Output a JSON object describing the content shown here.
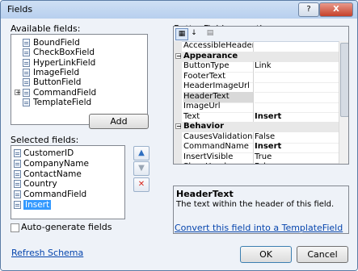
{
  "window": {
    "title": "Fields",
    "help_label": "?",
    "close_label": "X"
  },
  "available": {
    "label": "Available fields:",
    "items": [
      {
        "label": "BoundField",
        "expandable": false
      },
      {
        "label": "CheckBoxField",
        "expandable": false
      },
      {
        "label": "HyperLinkField",
        "expandable": false
      },
      {
        "label": "ImageField",
        "expandable": false
      },
      {
        "label": "ButtonField",
        "expandable": false
      },
      {
        "label": "CommandField",
        "expandable": true
      },
      {
        "label": "TemplateField",
        "expandable": false
      }
    ]
  },
  "add_button": "Add",
  "selected": {
    "label": "Selected fields:",
    "items": [
      "CustomerID",
      "CompanyName",
      "ContactName",
      "Country",
      "CommandField",
      "Insert"
    ],
    "selected_item": "Insert"
  },
  "autogen": {
    "label": "Auto-generate fields",
    "checked": false
  },
  "refresh_link": "Refresh Schema",
  "properties": {
    "label": "ButtonField properties:",
    "rows": [
      {
        "kind": "prop",
        "name": "AccessibleHeaderText",
        "value": ""
      },
      {
        "kind": "cat",
        "name": "Appearance"
      },
      {
        "kind": "prop",
        "name": "ButtonType",
        "value": "Link"
      },
      {
        "kind": "prop",
        "name": "FooterText",
        "value": ""
      },
      {
        "kind": "prop",
        "name": "HeaderImageUrl",
        "value": ""
      },
      {
        "kind": "prop",
        "name": "HeaderText",
        "value": "",
        "selected": true
      },
      {
        "kind": "prop",
        "name": "ImageUrl",
        "value": ""
      },
      {
        "kind": "prop",
        "name": "Text",
        "value": "Insert",
        "bold": true
      },
      {
        "kind": "cat",
        "name": "Behavior"
      },
      {
        "kind": "prop",
        "name": "CausesValidation",
        "value": "False"
      },
      {
        "kind": "prop",
        "name": "CommandName",
        "value": "Insert",
        "bold": true
      },
      {
        "kind": "prop",
        "name": "InsertVisible",
        "value": "True"
      },
      {
        "kind": "prop",
        "name": "ShowHeader",
        "value": "False"
      }
    ]
  },
  "description": {
    "title": "HeaderText",
    "text": "The text within the header of this field."
  },
  "convert_link": "Convert this field into a TemplateField",
  "ok_button": "OK",
  "cancel_button": "Cancel",
  "colors": {
    "selection": "#3399ff",
    "link": "#0645ad",
    "delete": "#d9261c"
  }
}
